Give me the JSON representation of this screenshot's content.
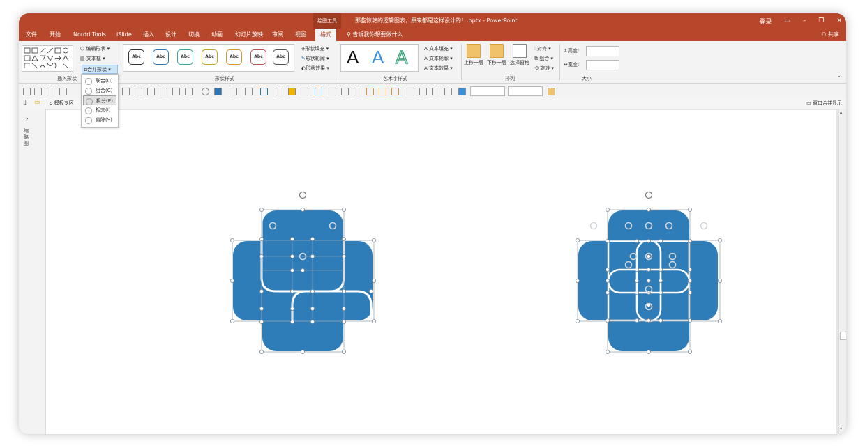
{
  "titlebar": {
    "context_tab": "绘图工具",
    "title": "那些惊艳的逻辑图表，原来都是这样设计的！.pptx  -  PowerPoint",
    "login": "登录",
    "ribbon_display_icon": "ribbon-display-icon",
    "minimize": "–",
    "restore": "❐",
    "close": "✕"
  },
  "menu": {
    "tabs": [
      "文件",
      "开始",
      "Nordri Tools",
      "iSlide",
      "插入",
      "设计",
      "切换",
      "动画",
      "幻灯片放映",
      "审阅",
      "视图",
      "格式"
    ],
    "active": "格式",
    "tell_me": "告诉我你想要做什么",
    "share": "共享"
  },
  "ribbon": {
    "insert_shapes": {
      "label": "插入形状",
      "edit_shape": "编辑形状",
      "text_box": "文本框",
      "merge_shapes": "合并形状"
    },
    "shape_styles": {
      "label": "形状样式",
      "abc": "Abc",
      "fill": "形状填充",
      "outline": "形状轮廓",
      "effects": "形状效果",
      "style_colors": [
        "#333333",
        "#2e75b6",
        "#3aa0a0",
        "#c9a227",
        "#e0922f",
        "#c0504d",
        "#555555"
      ]
    },
    "wordart": {
      "label": "艺术字样式",
      "letter": "A",
      "text_fill": "文本填充",
      "text_outline": "文本轮廓",
      "text_effects": "文本效果"
    },
    "arrange": {
      "label": "排列",
      "bring_forward": "上移一层",
      "send_backward": "下移一层",
      "selection_pane": "选择窗格",
      "align": "对齐",
      "group": "组合",
      "rotate": "旋转"
    },
    "size": {
      "label": "大小",
      "height": "高度:",
      "width": "宽度:"
    }
  },
  "merge_dropdown": {
    "items": [
      "联合(U)",
      "组合(C)",
      "拆分(E)",
      "相交(I)",
      "剪除(S)"
    ],
    "selected": "拆分(E)"
  },
  "docbar": {
    "template_tab": "模板专区",
    "merge_display": "窗口合并显示"
  },
  "left_pane": {
    "label": "缩略图"
  },
  "colors": {
    "accent": "#b7472a",
    "shape_fill": "#2e7cb8",
    "handle": "#ffffff"
  }
}
